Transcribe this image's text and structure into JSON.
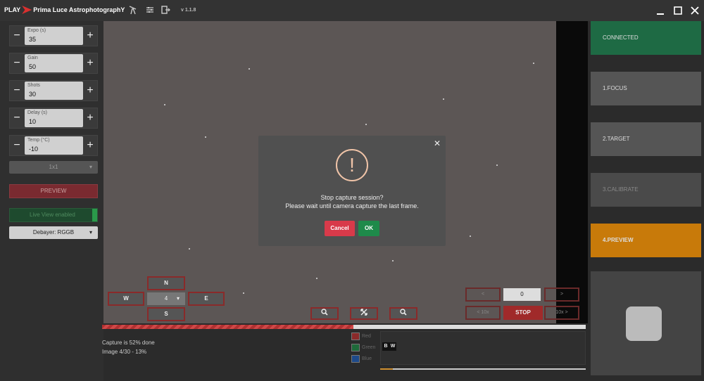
{
  "app": {
    "brand_prefix": "PLAY",
    "brand_name": "Prima Luce AstrophotographY",
    "version": "v 1.1.8"
  },
  "titlebar": {
    "icons": [
      "telescope-icon",
      "sliders-icon",
      "export-icon"
    ],
    "window_controls": [
      "minimize-icon",
      "maximize-icon",
      "close-icon"
    ]
  },
  "settings": {
    "expo": {
      "label": "Expo (s)",
      "value": "35"
    },
    "gain": {
      "label": "Gain",
      "value": "50"
    },
    "shots": {
      "label": "Shots",
      "value": "30"
    },
    "delay": {
      "label": "Delay (s)",
      "value": "10"
    },
    "temp": {
      "label": "Temp (°C)",
      "value": "-10"
    },
    "binning": "1x1",
    "preview_label": "PREVIEW",
    "liveview_label": "Live View enabled",
    "debayer": "Debayer: RGGB",
    "minus": "−",
    "plus": "+"
  },
  "guide": {
    "north": "N",
    "south": "S",
    "west": "W",
    "east": "E",
    "step": "4"
  },
  "frames": {
    "prev": "<",
    "next": ">",
    "prev10": "< 10x",
    "next10": "10x >",
    "current": "0",
    "stop": "STOP"
  },
  "status": {
    "capture": "Capture is 52% done",
    "image": "Image 4/30 - 13%",
    "progress_percent": 52
  },
  "histogram": {
    "channels": [
      "Red",
      "Green",
      "Blue"
    ],
    "channel_colors": [
      "#8a2a2a",
      "#1e6a3a",
      "#1e4a8a"
    ],
    "b": "B",
    "w": "W"
  },
  "steps": [
    {
      "label": "CONNECTED",
      "color": "#1e6a44"
    },
    {
      "label": "1.FOCUS",
      "color": "#555555"
    },
    {
      "label": "2.TARGET",
      "color": "#555555"
    },
    {
      "label": "3.CALIBRATE",
      "color": "#4a4a4a"
    },
    {
      "label": "4.PREVIEW",
      "color": "#c87a0a"
    }
  ],
  "modal": {
    "title": "Stop capture session?",
    "message": "Please wait until camera capture the last frame.",
    "cancel": "Cancel",
    "ok": "OK",
    "warning_glyph": "!",
    "close_glyph": "✕",
    "cancel_color": "#d83a4a",
    "ok_color": "#1e8a4a"
  }
}
